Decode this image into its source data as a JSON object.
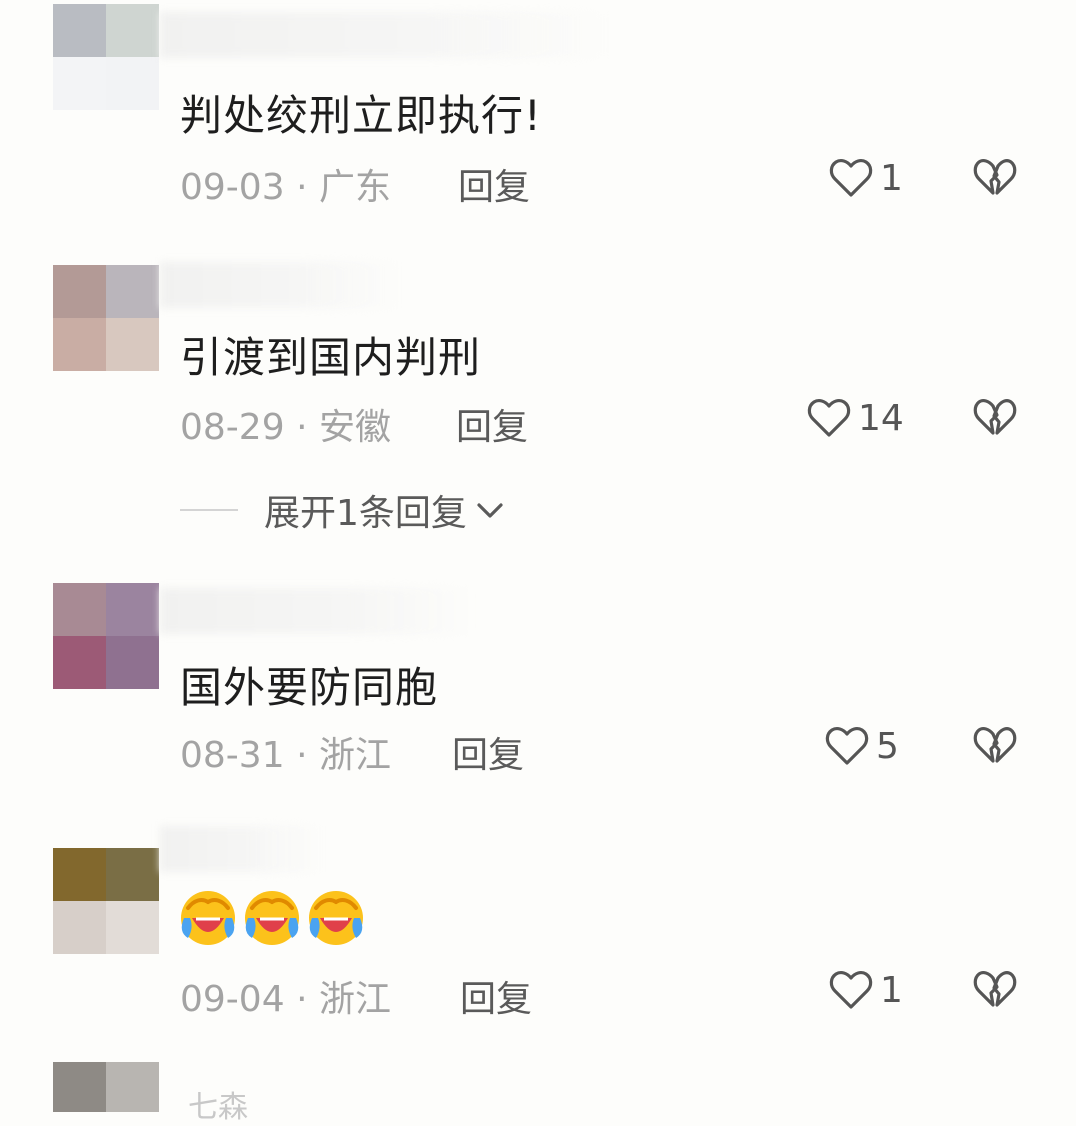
{
  "comments": [
    {
      "text": "判处绞刑立即执行!",
      "date": "09-03",
      "separator": "·",
      "location": "广东",
      "reply_label": "回复",
      "likes": "1",
      "avatar_colors": [
        "#b9bcc2",
        "#cfd5d1",
        "#f3f4f6",
        "#f2f3f5"
      ]
    },
    {
      "text": "引渡到国内判刑",
      "date": "08-29",
      "separator": "·",
      "location": "安徽",
      "reply_label": "回复",
      "likes": "14",
      "expand_label": "展开1条回复",
      "avatar_colors": [
        "#b39a96",
        "#bab5bb",
        "#c9ada4",
        "#d8c8bf"
      ]
    },
    {
      "text": "国外要防同胞",
      "date": "08-31",
      "separator": "·",
      "location": "浙江",
      "reply_label": "回复",
      "likes": "5",
      "avatar_colors": [
        "#a88a94",
        "#9b849f",
        "#9c5a76",
        "#8f7190"
      ]
    },
    {
      "text": "",
      "emoji_count": 3,
      "emoji_name": "rolling-laughing-crying-emoji",
      "date": "09-04",
      "separator": "·",
      "location": "浙江",
      "reply_label": "回复",
      "likes": "1",
      "avatar_colors": [
        "#82682d",
        "#7a6e45",
        "#d7cfc9",
        "#e2dcd7"
      ]
    }
  ],
  "partial_comment": {
    "visible_text": "七森",
    "avatar_colors": [
      "#8e8a85",
      "#b8b5b1"
    ]
  },
  "icons": {
    "like": "heart-outline-icon",
    "dislike": "broken-heart-icon",
    "expand": "chevron-down-icon"
  }
}
